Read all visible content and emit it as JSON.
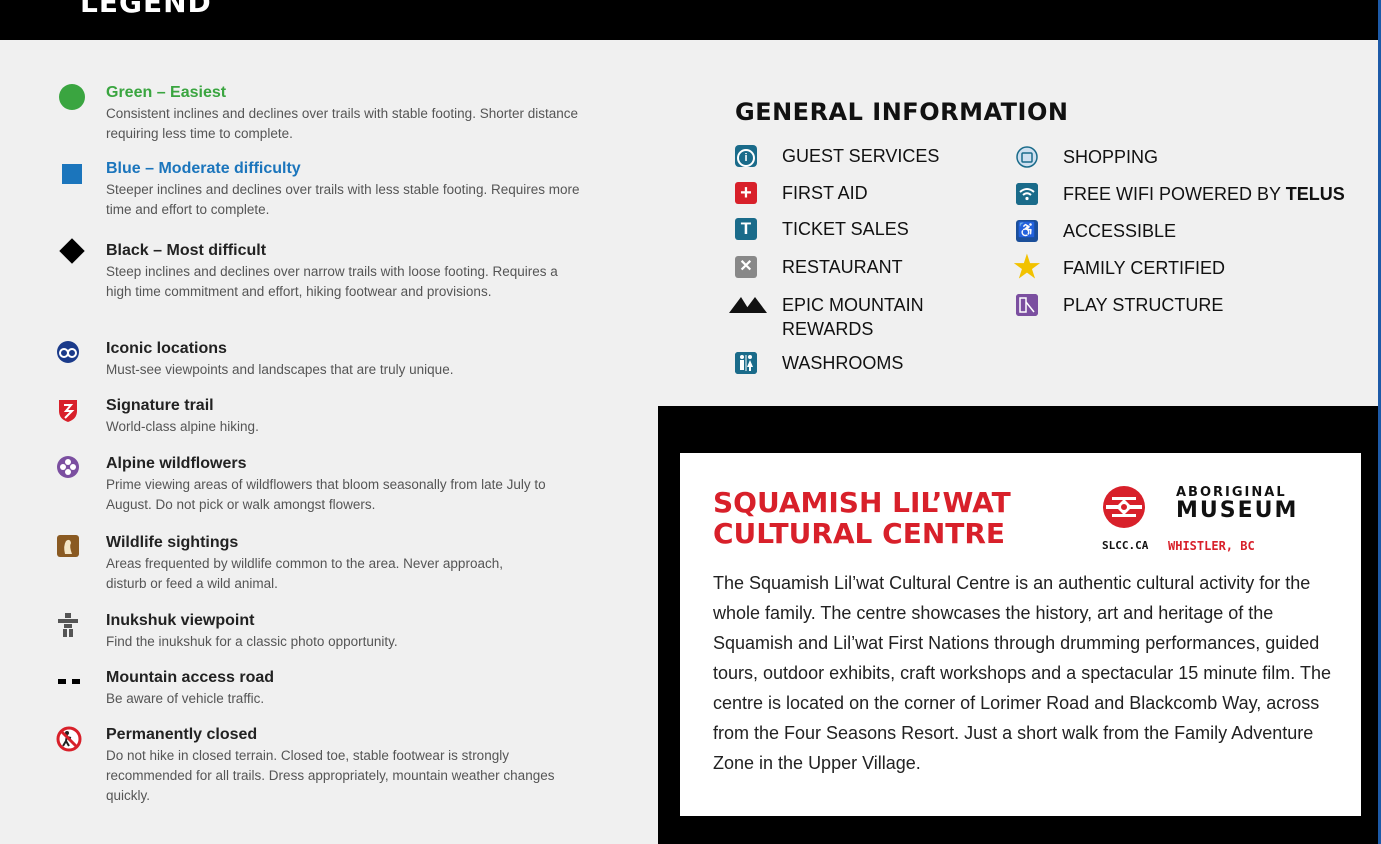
{
  "header": {
    "title": "LEGEND"
  },
  "legend": [
    {
      "title": "Green – Easiest",
      "desc": "Consistent inclines and declines over trails with stable footing. Shorter distance requiring less time to complete.",
      "icon": "green-circle-icon"
    },
    {
      "title": "Blue – Moderate difficulty",
      "desc": "Steeper inclines and declines over trails with less stable footing. Requires more time and effort to complete.",
      "icon": "blue-square-icon"
    },
    {
      "title": "Black – Most difficult",
      "desc": "Steep inclines and declines over narrow trails with loose footing. Requires a high time commitment and effort, hiking footwear and provisions.",
      "icon": "black-diamond-icon"
    },
    {
      "title": "Iconic locations",
      "desc": "Must-see viewpoints and landscapes that are truly unique.",
      "icon": "binoculars-icon"
    },
    {
      "title": "Signature trail",
      "desc": "World-class alpine hiking.",
      "icon": "signature-trail-icon"
    },
    {
      "title": "Alpine wildflowers",
      "desc": "Prime viewing areas of wildflowers that bloom seasonally from late July to August. Do not pick or walk amongst flowers.",
      "icon": "flower-icon"
    },
    {
      "title": "Wildlife sightings",
      "desc": "Areas frequented by wildlife common to the area. Never approach, disturb or feed a wild animal.",
      "icon": "marmot-icon"
    },
    {
      "title": "Inukshuk viewpoint",
      "desc": "Find the inukshuk for a classic photo opportunity.",
      "icon": "inukshuk-icon"
    },
    {
      "title": "Mountain access road",
      "desc": "Be aware of vehicle traffic.",
      "icon": "dashed-line-icon"
    },
    {
      "title": "Permanently closed",
      "desc": "Do not hike in closed terrain. Closed toe, stable footwear is strongly recommended for all trails. Dress appropriately, mountain weather changes quickly.",
      "icon": "no-hiking-icon"
    }
  ],
  "general_info": {
    "title": "GENERAL INFORMATION",
    "left": [
      {
        "label": "GUEST SERVICES",
        "icon": "info-icon",
        "glyph": "i"
      },
      {
        "label": "FIRST AID",
        "icon": "first-aid-icon",
        "glyph": "+"
      },
      {
        "label": "TICKET SALES",
        "icon": "ticket-icon",
        "glyph": "T"
      },
      {
        "label": "RESTAURANT",
        "icon": "restaurant-icon",
        "glyph": "✕"
      },
      {
        "label": "EPIC MOUNTAIN REWARDS",
        "icon": "mountain-icon",
        "glyph": ""
      },
      {
        "label": "WASHROOMS",
        "icon": "washroom-icon",
        "glyph": "🚻"
      }
    ],
    "right": [
      {
        "label": "SHOPPING",
        "icon": "shopping-icon",
        "glyph": ""
      },
      {
        "label_prefix": "FREE WIFI POWERED BY",
        "label_bold": "TELUS",
        "icon": "wifi-icon"
      },
      {
        "label": "ACCESSIBLE",
        "icon": "accessible-icon",
        "glyph": "♿"
      },
      {
        "label": "FAMILY CERTIFIED",
        "icon": "star-icon",
        "glyph": "★"
      },
      {
        "label": "PLAY STRUCTURE",
        "icon": "play-structure-icon",
        "glyph": ""
      }
    ]
  },
  "cultural_centre": {
    "title": "SQUAMISH LIL’WAT CULTURAL CENTRE",
    "logo_top": "ABORIGINAL",
    "logo_big": "MUSEUM",
    "logo_url": "SLCC.CA",
    "logo_place": "WHISTLER, BC",
    "body": "The Squamish Lil’wat Cultural Centre is an authentic cultural activity for the whole family. The centre showcases the history, art and heritage of the Squamish and Lil’wat First Nations through drumming performances, guided tours, outdoor exhibits, craft workshops and a spectacular 15 minute film. The centre is located on the corner of Lorimer Road and Blackcomb Way, across from the Four Seasons Resort. Just a short walk from the Family Adventure Zone in the Upper Village."
  },
  "colors": {
    "green": "#3aa540",
    "blue": "#1b75bc",
    "red": "#d8202a",
    "purple": "#7b4fa0",
    "teal": "#1a6b8a"
  }
}
